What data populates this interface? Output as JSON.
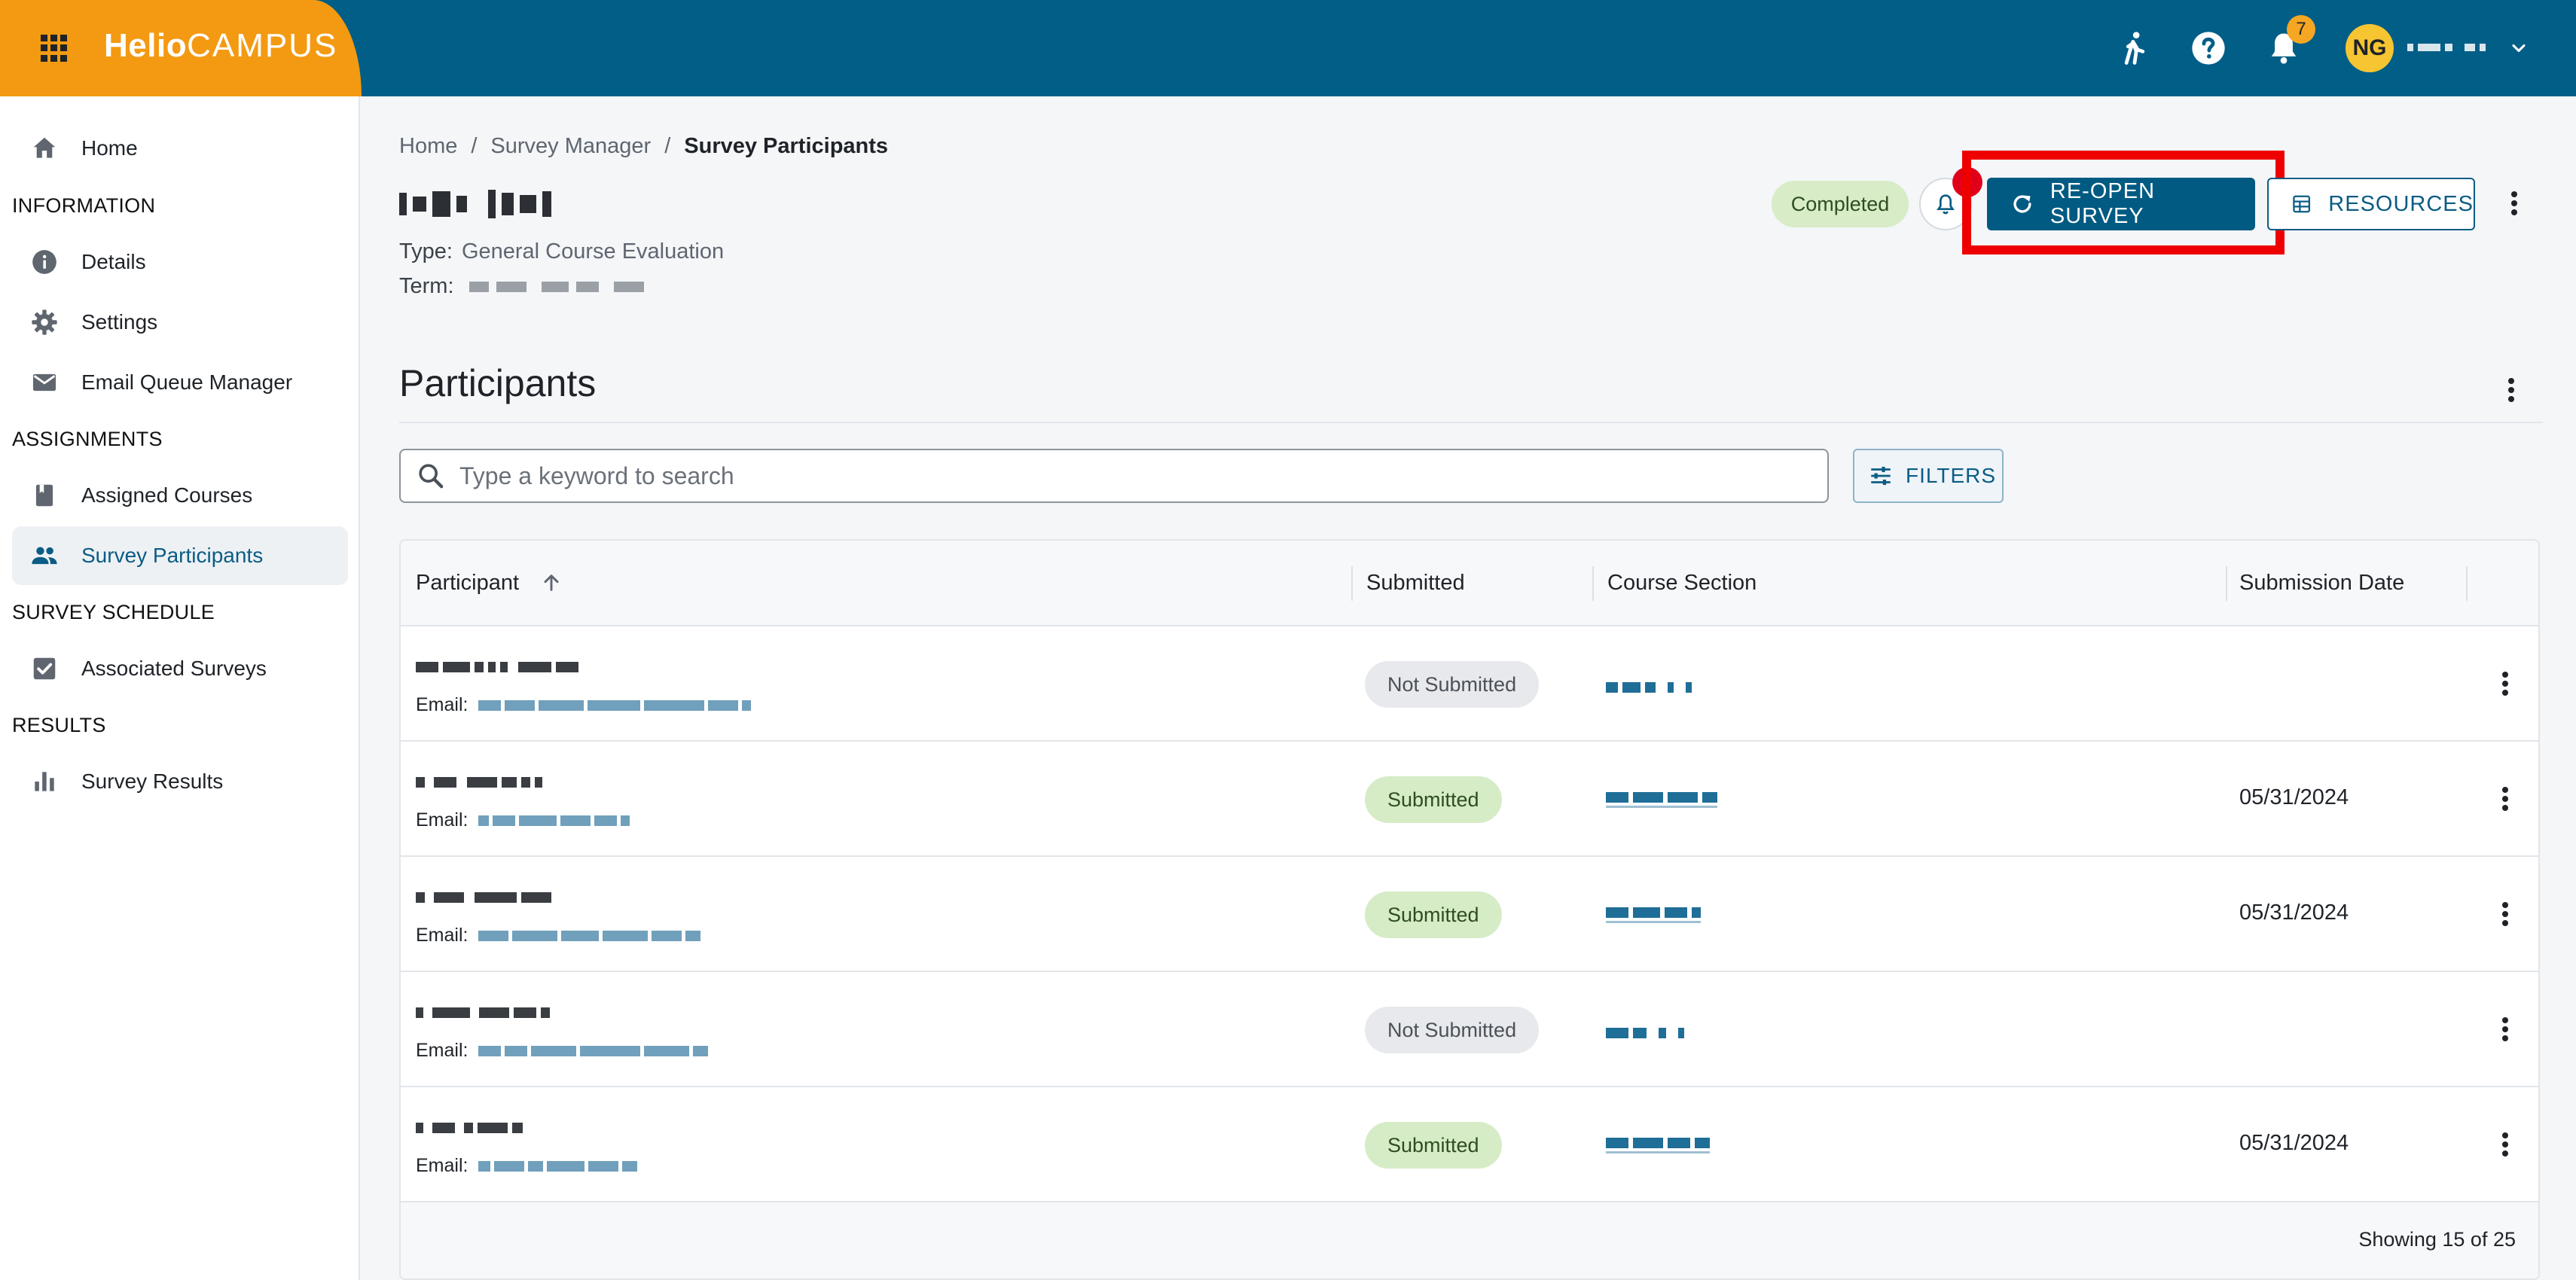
{
  "brand": {
    "name_bold": "Helio",
    "name_light": "CAMPUS"
  },
  "topbar": {
    "notification_count": "7",
    "avatar_initials": "NG"
  },
  "sidebar": {
    "home": "Home",
    "sections": {
      "information": "INFORMATION",
      "assignments": "ASSIGNMENTS",
      "survey_schedule": "SURVEY SCHEDULE",
      "results": "RESULTS"
    },
    "items": {
      "details": "Details",
      "settings": "Settings",
      "email_queue_manager": "Email Queue Manager",
      "assigned_courses": "Assigned Courses",
      "survey_participants": "Survey Participants",
      "associated_surveys": "Associated Surveys",
      "survey_results": "Survey Results"
    },
    "active_item": "survey_participants"
  },
  "breadcrumb": {
    "home": "Home",
    "separator": "/",
    "survey_manager": "Survey Manager",
    "current": "Survey Participants"
  },
  "survey": {
    "type_label": "Type:",
    "type_value": "General Course Evaluation",
    "term_label": "Term:",
    "status": "Completed"
  },
  "actions": {
    "reopen_label": "RE-OPEN SURVEY",
    "resources_label": "RESOURCES"
  },
  "participants": {
    "title": "Participants",
    "search_placeholder": "Type a keyword to search",
    "search_value": "",
    "filters_label": "FILTERS",
    "columns": {
      "participant": "Participant",
      "submitted": "Submitted",
      "course_section": "Course Section",
      "submission_date": "Submission Date"
    },
    "sort": {
      "column": "participant",
      "direction": "ascending"
    },
    "email_label": "Email:",
    "rows": [
      {
        "submitted": "Not Submitted",
        "status_kind": "not",
        "submission_date": ""
      },
      {
        "submitted": "Submitted",
        "status_kind": "submitted",
        "submission_date": "05/31/2024"
      },
      {
        "submitted": "Submitted",
        "status_kind": "submitted",
        "submission_date": "05/31/2024"
      },
      {
        "submitted": "Not Submitted",
        "status_kind": "not",
        "submission_date": ""
      },
      {
        "submitted": "Submitted",
        "status_kind": "submitted",
        "submission_date": "05/31/2024"
      }
    ],
    "footer": "Showing 15 of 25"
  },
  "colors": {
    "topbar": "#005e87",
    "brand": "#f39a12",
    "primary_button": "#005a82",
    "highlight": "#ee0000",
    "submitted_pill": "#d6ecc7",
    "not_submitted_pill": "#e7e9ec"
  },
  "icons": {
    "apps": "apps-grid-icon",
    "accessibility": "walking-person-icon",
    "help": "help-circle-icon",
    "notifications": "bell-icon",
    "user_menu": "chevron-down-icon",
    "home": "home-icon",
    "details": "info-icon",
    "settings": "gear-icon",
    "email_queue": "envelope-icon",
    "assigned_courses": "book-icon",
    "survey_participants": "people-icon",
    "associated_surveys": "checkbox-icon",
    "survey_results": "bar-chart-icon",
    "reminder": "bell-outline-icon",
    "reopen": "refresh-icon",
    "resources": "resources-icon",
    "search": "search-icon",
    "filters": "sliders-icon",
    "sort": "arrow-up-icon",
    "more": "kebab-icon"
  }
}
